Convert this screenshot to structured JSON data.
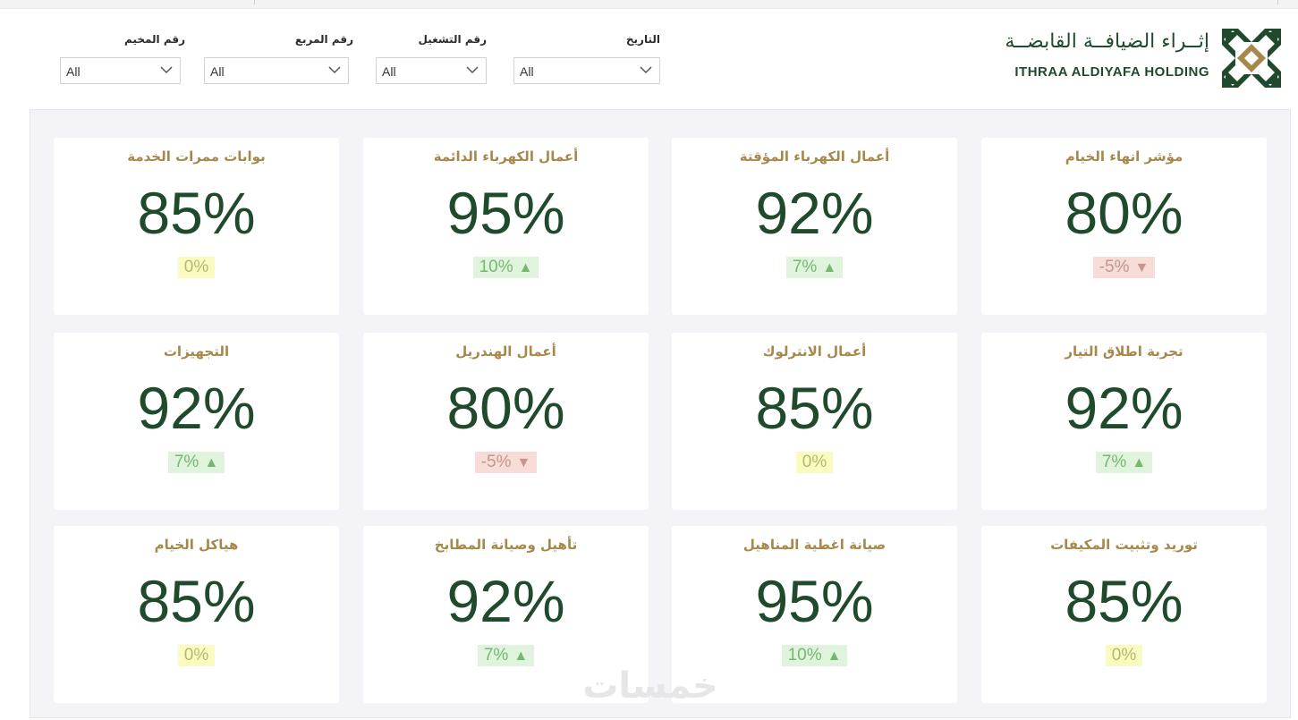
{
  "brand": {
    "name_ar": "إثــراء الضيافــة القابضــة",
    "name_en": "ITHRAA ALDIYAFA HOLDING",
    "logo_icon": "ithraa-logo-icon"
  },
  "filters": [
    {
      "label": "التاريخ",
      "value": "All"
    },
    {
      "label": "رقم التشغيل",
      "value": "All"
    },
    {
      "label": "رقم المربع",
      "value": "All"
    },
    {
      "label": "رقم المخيم",
      "value": "All"
    }
  ],
  "colors": {
    "title": "#a8884a",
    "value": "#1f4b2c",
    "up_bg": "#dff3dd",
    "down_bg": "#f8dcd8",
    "flat_bg": "#fafbc0"
  },
  "cards": [
    {
      "title": "مؤشر انهاء الخيام",
      "value": "80%",
      "delta": "-5%",
      "trend": "down"
    },
    {
      "title": "أعمال الكهرباء المؤقتة",
      "value": "92%",
      "delta": "7%",
      "trend": "up"
    },
    {
      "title": "أعمال الكهرباء الدائمة",
      "value": "95%",
      "delta": "10%",
      "trend": "up"
    },
    {
      "title": "بوابات ممرات الخدمة",
      "value": "85%",
      "delta": "0%",
      "trend": "flat"
    },
    {
      "title": "تجربة اطلاق التيار",
      "value": "92%",
      "delta": "7%",
      "trend": "up"
    },
    {
      "title": "أعمال الانترلوك",
      "value": "85%",
      "delta": "0%",
      "trend": "flat"
    },
    {
      "title": "أعمال الهندريل",
      "value": "80%",
      "delta": "-5%",
      "trend": "down"
    },
    {
      "title": "التجهيزات",
      "value": "92%",
      "delta": "7%",
      "trend": "up"
    },
    {
      "title": "توريد وتثبيت المكيفات",
      "value": "85%",
      "delta": "0%",
      "trend": "flat"
    },
    {
      "title": "صيانة اغطية المناهيل",
      "value": "95%",
      "delta": "10%",
      "trend": "up"
    },
    {
      "title": "تأهيل وصيانة المطابخ",
      "value": "92%",
      "delta": "7%",
      "trend": "up"
    },
    {
      "title": "هياكل الخيام",
      "value": "85%",
      "delta": "0%",
      "trend": "flat"
    }
  ],
  "watermark": "خمسات"
}
